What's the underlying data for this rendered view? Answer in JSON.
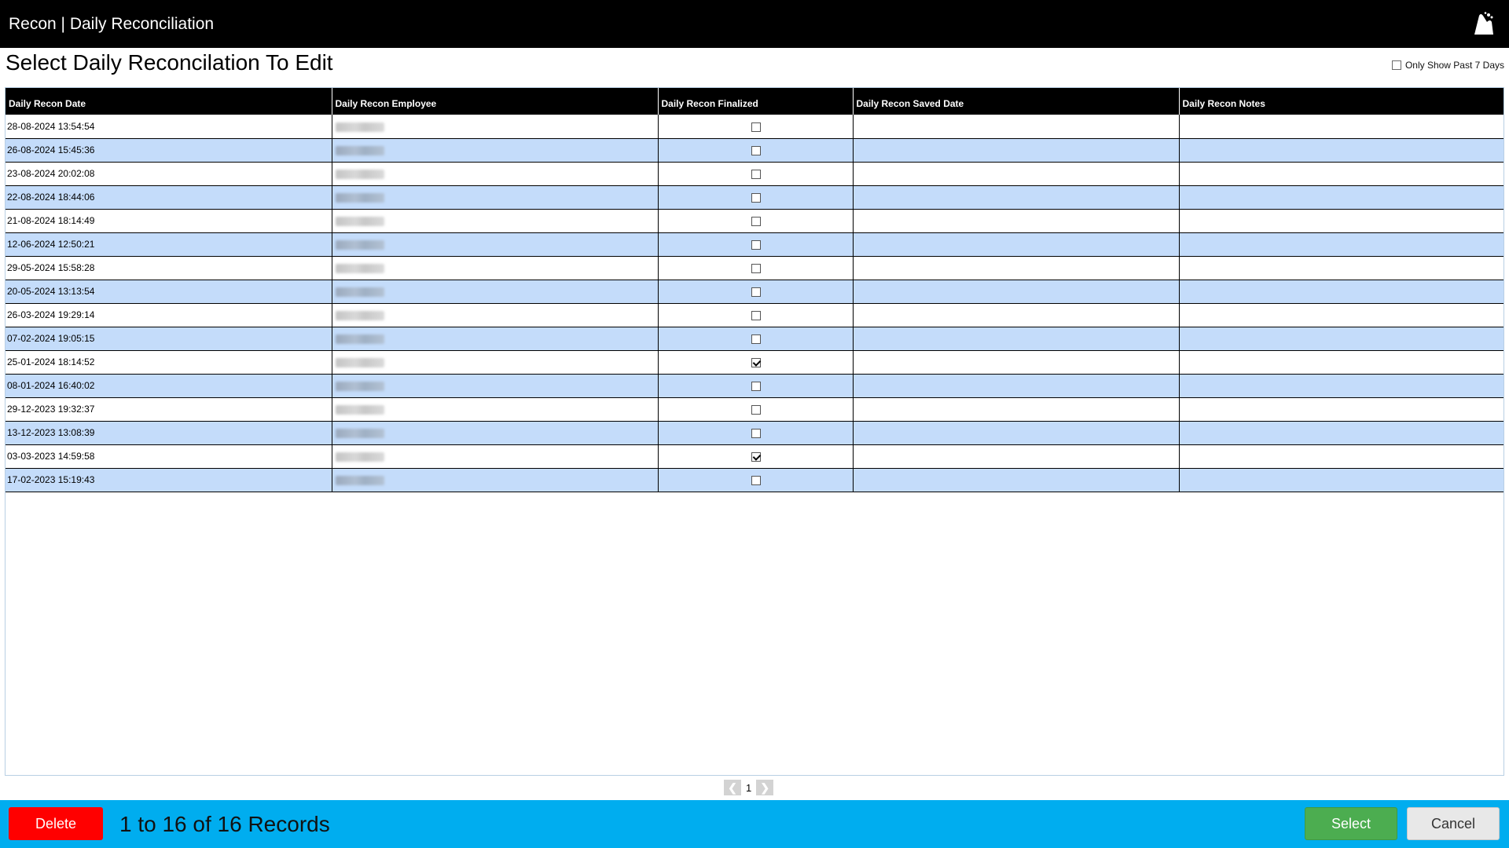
{
  "app": {
    "title": "Recon | Daily Reconciliation"
  },
  "page": {
    "heading": "Select Daily Reconcilation To Edit"
  },
  "filter": {
    "label": "Only Show Past 7 Days",
    "checked": false
  },
  "table": {
    "columns": [
      "Daily Recon Date",
      "Daily Recon Employee",
      "Daily Recon Finalized",
      "Daily Recon Saved Date",
      "Daily Recon Notes"
    ],
    "rows": [
      {
        "date": "28-08-2024 13:54:54",
        "finalized": false,
        "saved": "",
        "notes": ""
      },
      {
        "date": "26-08-2024 15:45:36",
        "finalized": false,
        "saved": "",
        "notes": ""
      },
      {
        "date": "23-08-2024 20:02:08",
        "finalized": false,
        "saved": "",
        "notes": ""
      },
      {
        "date": "22-08-2024 18:44:06",
        "finalized": false,
        "saved": "",
        "notes": ""
      },
      {
        "date": "21-08-2024 18:14:49",
        "finalized": false,
        "saved": "",
        "notes": ""
      },
      {
        "date": "12-06-2024 12:50:21",
        "finalized": false,
        "saved": "",
        "notes": ""
      },
      {
        "date": "29-05-2024 15:58:28",
        "finalized": false,
        "saved": "",
        "notes": ""
      },
      {
        "date": "20-05-2024 13:13:54",
        "finalized": false,
        "saved": "",
        "notes": ""
      },
      {
        "date": "26-03-2024 19:29:14",
        "finalized": false,
        "saved": "",
        "notes": ""
      },
      {
        "date": "07-02-2024 19:05:15",
        "finalized": false,
        "saved": "",
        "notes": ""
      },
      {
        "date": "25-01-2024 18:14:52",
        "finalized": true,
        "saved": "",
        "notes": ""
      },
      {
        "date": "08-01-2024 16:40:02",
        "finalized": false,
        "saved": "",
        "notes": ""
      },
      {
        "date": "29-12-2023 19:32:37",
        "finalized": false,
        "saved": "",
        "notes": ""
      },
      {
        "date": "13-12-2023 13:08:39",
        "finalized": false,
        "saved": "",
        "notes": ""
      },
      {
        "date": "03-03-2023 14:59:58",
        "finalized": true,
        "saved": "",
        "notes": ""
      },
      {
        "date": "17-02-2023 15:19:43",
        "finalized": false,
        "saved": "",
        "notes": ""
      }
    ]
  },
  "pager": {
    "current_page": "1",
    "prev_icon": "chevron-left-icon",
    "next_icon": "chevron-right-icon"
  },
  "footer": {
    "delete_label": "Delete",
    "records_text": "1 to 16 of 16 Records",
    "select_label": "Select",
    "cancel_label": "Cancel"
  },
  "colors": {
    "titlebar": "#000000",
    "bottombar": "#00adef",
    "row_alt": "#c4dcfa",
    "delete": "#ff0000",
    "select": "#4cad50",
    "cancel": "#e8e8e8"
  }
}
